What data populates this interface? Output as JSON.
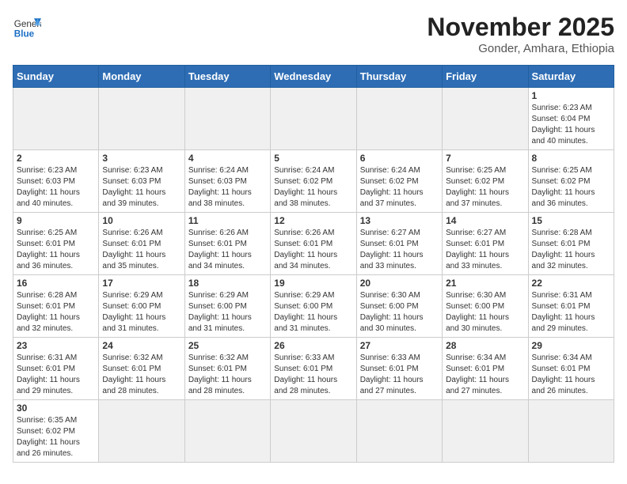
{
  "logo": {
    "general": "General",
    "blue": "Blue"
  },
  "header": {
    "month": "November 2025",
    "location": "Gonder, Amhara, Ethiopia"
  },
  "weekdays": [
    "Sunday",
    "Monday",
    "Tuesday",
    "Wednesday",
    "Thursday",
    "Friday",
    "Saturday"
  ],
  "weeks": [
    [
      {
        "day": "",
        "info": ""
      },
      {
        "day": "",
        "info": ""
      },
      {
        "day": "",
        "info": ""
      },
      {
        "day": "",
        "info": ""
      },
      {
        "day": "",
        "info": ""
      },
      {
        "day": "",
        "info": ""
      },
      {
        "day": "1",
        "info": "Sunrise: 6:23 AM\nSunset: 6:04 PM\nDaylight: 11 hours\nand 40 minutes."
      }
    ],
    [
      {
        "day": "2",
        "info": "Sunrise: 6:23 AM\nSunset: 6:03 PM\nDaylight: 11 hours\nand 40 minutes."
      },
      {
        "day": "3",
        "info": "Sunrise: 6:23 AM\nSunset: 6:03 PM\nDaylight: 11 hours\nand 39 minutes."
      },
      {
        "day": "4",
        "info": "Sunrise: 6:24 AM\nSunset: 6:03 PM\nDaylight: 11 hours\nand 38 minutes."
      },
      {
        "day": "5",
        "info": "Sunrise: 6:24 AM\nSunset: 6:02 PM\nDaylight: 11 hours\nand 38 minutes."
      },
      {
        "day": "6",
        "info": "Sunrise: 6:24 AM\nSunset: 6:02 PM\nDaylight: 11 hours\nand 37 minutes."
      },
      {
        "day": "7",
        "info": "Sunrise: 6:25 AM\nSunset: 6:02 PM\nDaylight: 11 hours\nand 37 minutes."
      },
      {
        "day": "8",
        "info": "Sunrise: 6:25 AM\nSunset: 6:02 PM\nDaylight: 11 hours\nand 36 minutes."
      }
    ],
    [
      {
        "day": "9",
        "info": "Sunrise: 6:25 AM\nSunset: 6:01 PM\nDaylight: 11 hours\nand 36 minutes."
      },
      {
        "day": "10",
        "info": "Sunrise: 6:26 AM\nSunset: 6:01 PM\nDaylight: 11 hours\nand 35 minutes."
      },
      {
        "day": "11",
        "info": "Sunrise: 6:26 AM\nSunset: 6:01 PM\nDaylight: 11 hours\nand 34 minutes."
      },
      {
        "day": "12",
        "info": "Sunrise: 6:26 AM\nSunset: 6:01 PM\nDaylight: 11 hours\nand 34 minutes."
      },
      {
        "day": "13",
        "info": "Sunrise: 6:27 AM\nSunset: 6:01 PM\nDaylight: 11 hours\nand 33 minutes."
      },
      {
        "day": "14",
        "info": "Sunrise: 6:27 AM\nSunset: 6:01 PM\nDaylight: 11 hours\nand 33 minutes."
      },
      {
        "day": "15",
        "info": "Sunrise: 6:28 AM\nSunset: 6:01 PM\nDaylight: 11 hours\nand 32 minutes."
      }
    ],
    [
      {
        "day": "16",
        "info": "Sunrise: 6:28 AM\nSunset: 6:01 PM\nDaylight: 11 hours\nand 32 minutes."
      },
      {
        "day": "17",
        "info": "Sunrise: 6:29 AM\nSunset: 6:00 PM\nDaylight: 11 hours\nand 31 minutes."
      },
      {
        "day": "18",
        "info": "Sunrise: 6:29 AM\nSunset: 6:00 PM\nDaylight: 11 hours\nand 31 minutes."
      },
      {
        "day": "19",
        "info": "Sunrise: 6:29 AM\nSunset: 6:00 PM\nDaylight: 11 hours\nand 31 minutes."
      },
      {
        "day": "20",
        "info": "Sunrise: 6:30 AM\nSunset: 6:00 PM\nDaylight: 11 hours\nand 30 minutes."
      },
      {
        "day": "21",
        "info": "Sunrise: 6:30 AM\nSunset: 6:00 PM\nDaylight: 11 hours\nand 30 minutes."
      },
      {
        "day": "22",
        "info": "Sunrise: 6:31 AM\nSunset: 6:01 PM\nDaylight: 11 hours\nand 29 minutes."
      }
    ],
    [
      {
        "day": "23",
        "info": "Sunrise: 6:31 AM\nSunset: 6:01 PM\nDaylight: 11 hours\nand 29 minutes."
      },
      {
        "day": "24",
        "info": "Sunrise: 6:32 AM\nSunset: 6:01 PM\nDaylight: 11 hours\nand 28 minutes."
      },
      {
        "day": "25",
        "info": "Sunrise: 6:32 AM\nSunset: 6:01 PM\nDaylight: 11 hours\nand 28 minutes."
      },
      {
        "day": "26",
        "info": "Sunrise: 6:33 AM\nSunset: 6:01 PM\nDaylight: 11 hours\nand 28 minutes."
      },
      {
        "day": "27",
        "info": "Sunrise: 6:33 AM\nSunset: 6:01 PM\nDaylight: 11 hours\nand 27 minutes."
      },
      {
        "day": "28",
        "info": "Sunrise: 6:34 AM\nSunset: 6:01 PM\nDaylight: 11 hours\nand 27 minutes."
      },
      {
        "day": "29",
        "info": "Sunrise: 6:34 AM\nSunset: 6:01 PM\nDaylight: 11 hours\nand 26 minutes."
      }
    ],
    [
      {
        "day": "30",
        "info": "Sunrise: 6:35 AM\nSunset: 6:02 PM\nDaylight: 11 hours\nand 26 minutes."
      },
      {
        "day": "",
        "info": ""
      },
      {
        "day": "",
        "info": ""
      },
      {
        "day": "",
        "info": ""
      },
      {
        "day": "",
        "info": ""
      },
      {
        "day": "",
        "info": ""
      },
      {
        "day": "",
        "info": ""
      }
    ]
  ]
}
